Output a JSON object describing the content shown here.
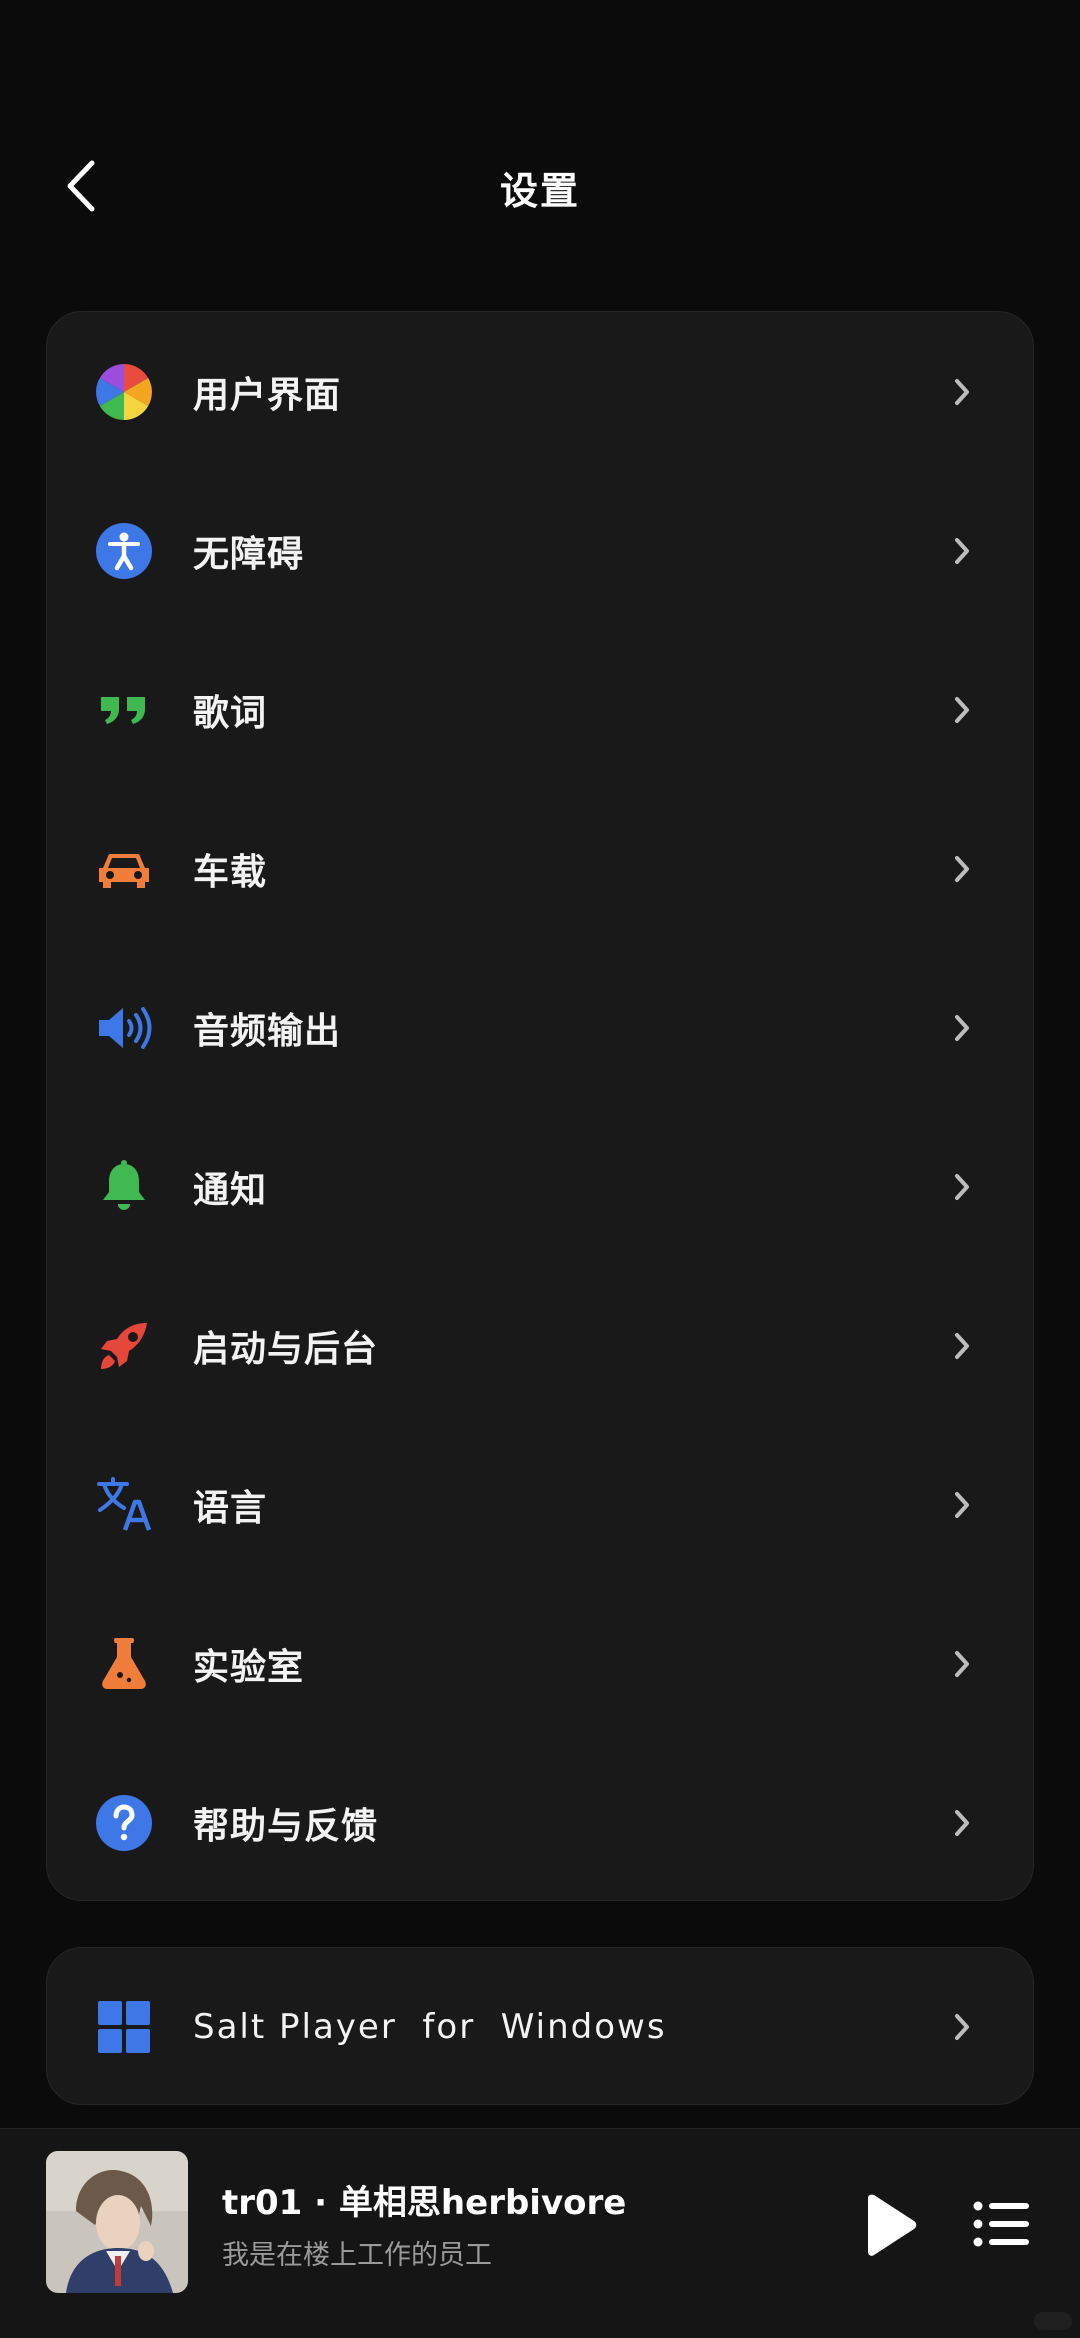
{
  "header": {
    "title": "设置"
  },
  "settings": {
    "items": [
      {
        "label": "用户界面",
        "icon": "color-wheel-icon"
      },
      {
        "label": "无障碍",
        "icon": "accessibility-icon",
        "color": "#3d78e6"
      },
      {
        "label": "歌词",
        "icon": "quote-icon",
        "color": "#3fb950"
      },
      {
        "label": "车载",
        "icon": "car-icon",
        "color": "#f07d3a"
      },
      {
        "label": "音频输出",
        "icon": "speaker-icon",
        "color": "#3d78e6"
      },
      {
        "label": "通知",
        "icon": "bell-icon",
        "color": "#3fb950"
      },
      {
        "label": "启动与后台",
        "icon": "rocket-icon",
        "color": "#e5473b"
      },
      {
        "label": "语言",
        "icon": "translate-icon",
        "color": "#3d78e6"
      },
      {
        "label": "实验室",
        "icon": "flask-icon",
        "color": "#f07d3a"
      },
      {
        "label": "帮助与反馈",
        "icon": "help-icon",
        "color": "#3d78e6"
      }
    ]
  },
  "windows": {
    "label": "Salt Player  for  Windows",
    "icon": "windows-logo-icon",
    "color": "#3d78e6"
  },
  "player": {
    "title": "tr01 · 单相思herbivore",
    "artist": "我是在楼上工作的员工"
  }
}
